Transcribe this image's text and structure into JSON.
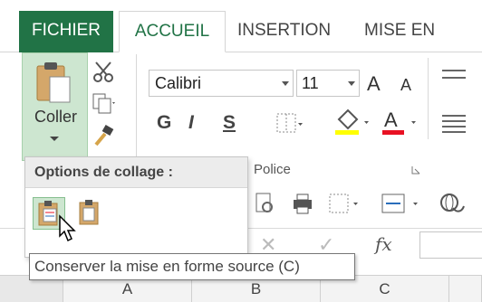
{
  "tabs": {
    "file": "FICHIER",
    "home": "ACCUEIL",
    "insert": "INSERTION",
    "layout": "MISE EN PAGE"
  },
  "clipboard": {
    "paste_label": "Coller"
  },
  "font": {
    "name": "Calibri",
    "size": "11",
    "bold": "G",
    "italic": "I",
    "underline": "S",
    "grow": "A",
    "shrink": "A",
    "group_label": "Police"
  },
  "paste_panel": {
    "title": "Options de collage :"
  },
  "tooltip": "Conserver la mise en forme source (C)",
  "formula_bar": {
    "fx": "fx",
    "cancel": "✕",
    "enter": "✓"
  },
  "columns": [
    "A",
    "B",
    "C"
  ],
  "colors": {
    "excel_green": "#217346",
    "selected_bg": "#cde6d0",
    "fill_yellow": "#ffff00",
    "font_red": "#e81123"
  }
}
